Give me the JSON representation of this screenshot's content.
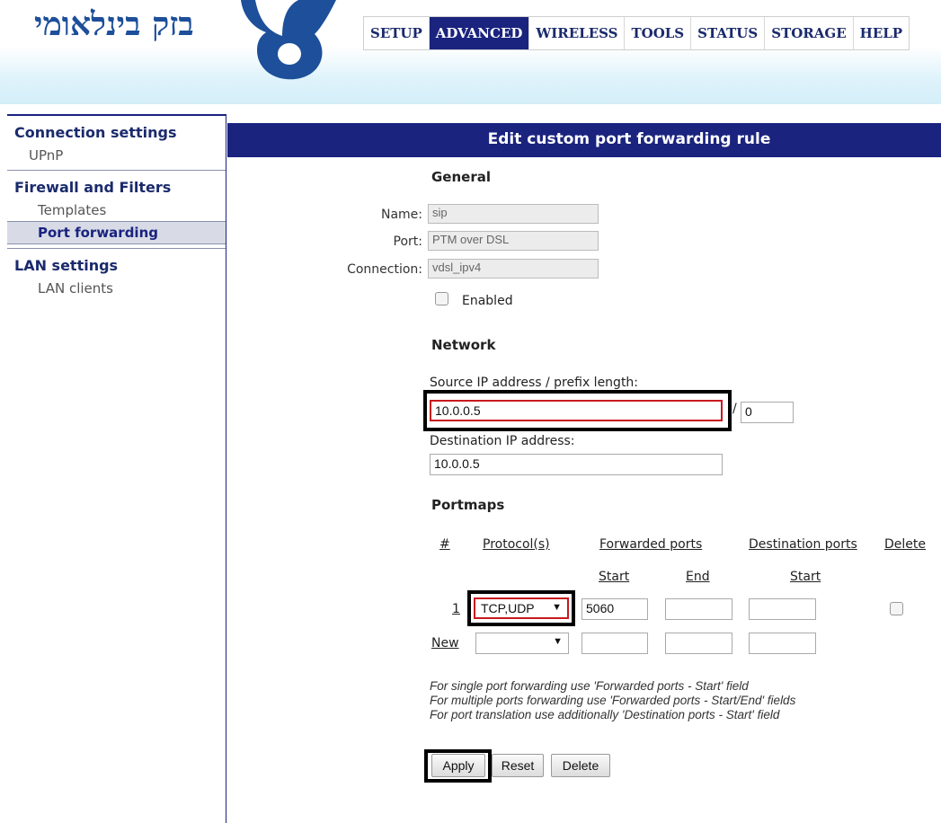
{
  "brand": {
    "logo_text": "בזק בינלאומי"
  },
  "topnav": {
    "tabs": [
      {
        "label": "SETUP"
      },
      {
        "label": "ADVANCED"
      },
      {
        "label": "WIRELESS"
      },
      {
        "label": "TOOLS"
      },
      {
        "label": "STATUS"
      },
      {
        "label": "STORAGE"
      },
      {
        "label": "HELP"
      }
    ],
    "active": "ADVANCED"
  },
  "sidebar": {
    "sections": [
      {
        "title": "Connection settings",
        "items": [
          "UPnP"
        ]
      },
      {
        "title": "Firewall and Filters",
        "items": [
          "Templates",
          "Port forwarding"
        ]
      },
      {
        "title": "LAN settings",
        "items": [
          "LAN clients"
        ]
      }
    ],
    "active_item": "Port forwarding"
  },
  "page": {
    "title": "Edit custom port forwarding rule"
  },
  "general": {
    "heading": "General",
    "name_label": "Name:",
    "name_value": "sip",
    "port_label": "Port:",
    "port_value": "PTM over DSL",
    "connection_label": "Connection:",
    "connection_value": "vdsl_ipv4",
    "enabled_label": "Enabled",
    "enabled": false
  },
  "network": {
    "heading": "Network",
    "source_label": "Source IP address / prefix length:",
    "source_ip": "10.0.0.5",
    "prefix_sep": "/",
    "prefix_length": "0",
    "dest_label": "Destination IP address:",
    "dest_ip": "10.0.0.5"
  },
  "portmaps": {
    "heading": "Portmaps",
    "col_num": "#",
    "col_protocol": "Protocol(s)",
    "col_forwarded": "Forwarded ports",
    "col_destination": "Destination ports",
    "col_delete": "Delete",
    "sub_start": "Start",
    "sub_end": "End",
    "sub_dest_start": "Start",
    "rows": [
      {
        "num": "1",
        "protocol": "TCP,UDP",
        "fwd_start": "5060",
        "fwd_end": "",
        "dest_start": ""
      }
    ],
    "new_row": {
      "label": "New",
      "protocol": "",
      "fwd_start": "",
      "fwd_end": "",
      "dest_start": ""
    }
  },
  "notes": [
    "For single port forwarding use 'Forwarded ports - Start' field",
    "For multiple ports forwarding use 'Forwarded ports - Start/End' fields",
    "For port translation use additionally 'Destination ports - Start' field"
  ],
  "buttons": {
    "apply": "Apply",
    "reset": "Reset",
    "delete": "Delete"
  },
  "colors": {
    "brand_navy": "#1a237e",
    "highlight_red": "#c8191e",
    "header_tint": "#d4eef8"
  }
}
